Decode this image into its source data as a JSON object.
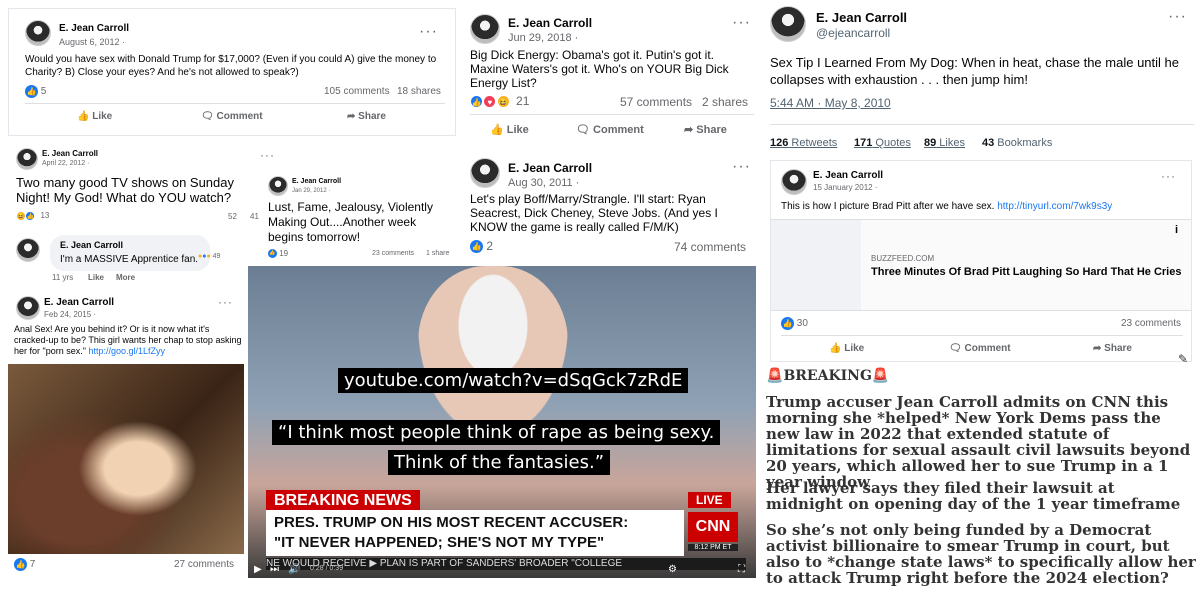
{
  "post1": {
    "name": "E. Jean Carroll",
    "date": "August 6, 2012 ·",
    "text": "Would you have sex with Donald Trump for $17,000?  (Even if you could A) give the money to Charity? B) Close your eyes?  And he's not allowed to speak?)",
    "reactions": "5",
    "comments": "105 comments",
    "shares": "18 shares",
    "like": "Like",
    "comment": "Comment",
    "share": "Share"
  },
  "post2": {
    "name": "E. Jean Carroll",
    "date": "Jun 29, 2018 ·",
    "text": "Big Dick Energy: Obama's got it. Putin's got it. Maxine Waters's got it. Who's on YOUR Big Dick Energy List?",
    "reactions": "21",
    "comments": "57 comments",
    "shares": "2 shares",
    "like": "Like",
    "comment": "Comment",
    "share": "Share"
  },
  "tweet": {
    "name": "E. Jean Carroll",
    "handle": "@ejeancarroll",
    "text": "Sex Tip I Learned From My Dog:  When in heat, chase the male until he collapses with exhaustion  . . . then jump him!",
    "timestamp": "5:44 AM · May 8, 2010",
    "retweets_num": "126",
    "retweets_label": " Retweets",
    "quotes_num": "171",
    "quotes_label": " Quotes",
    "likes_num": "89",
    "likes_label": " Likes",
    "bookmarks_num": "43",
    "bookmarks_label": " Bookmarks"
  },
  "post3": {
    "name": "E. Jean Carroll",
    "date": "April 22, 2012 ·",
    "text": "Two many good TV shows on Sunday Night! My God! What do YOU watch?",
    "reactions": "13",
    "comments": "52",
    "shares": "41",
    "reply_name": "E. Jean Carroll",
    "reply_text": "I'm a MASSIVE Apprentice fan.",
    "reply_reactions": "49",
    "reply_age": "11 yrs",
    "reply_like": "Like",
    "reply_more": "More"
  },
  "post4": {
    "name": "E. Jean Carroll",
    "date": "Jan 29, 2012 ·",
    "text": "Lust, Fame, Jealousy, Violently Making Out....Another week begins tomorrow!",
    "reactions": "19",
    "comments": "23 comments",
    "shares": "1 share"
  },
  "post5": {
    "name": "E. Jean Carroll",
    "date": "Aug 30, 2011 ·",
    "text": "Let's play Boff/Marry/Strangle.  I'll start: Ryan Seacrest, Dick Cheney, Steve Jobs.  (And yes I KNOW the game is really called F/M/K)",
    "reactions": "2",
    "comments": "74 comments"
  },
  "post6": {
    "name": "E. Jean Carroll",
    "date": "15 January 2012 ·",
    "text": "This is how I picture Brad Pitt after we have sex.",
    "link": "http://tinyurl.com/7wk9s3y",
    "source": "BUZZFEED.COM",
    "headline": "Three Minutes Of Brad Pitt Laughing So Hard That He Cries",
    "reactions": "30",
    "comments": "23 comments",
    "like": "Like",
    "comment": "Comment",
    "share": "Share"
  },
  "post7": {
    "name": "E. Jean Carroll",
    "date": "Feb 24, 2015 ·",
    "text": "Anal Sex!  Are you behind it? Or is it now what it's cracked-up to be? This girl wants her chap to stop asking her for \"porn sex.\"",
    "link": "http://goo.gl/1LfZyy",
    "reactions": "7",
    "comments": "27 comments"
  },
  "video": {
    "url": "youtube.com/watch?v=dSqGck7zRdE",
    "quote_line1": "“I think most people think of rape as being sexy.",
    "quote_line2": "Think of the fantasies.”",
    "banner_bg_text": "PLAN",
    "breaking": "BREAKING NEWS",
    "live": "LIVE",
    "headline_line1": "PRES. TRUMP ON HIS MOST RECENT ACCUSER:",
    "headline_line2": "\"IT NEVER HAPPENED; SHE'S NOT MY TYPE\"",
    "network": "CNN",
    "time": "8:12 PM ET",
    "ticker": "NE WOULD RECEIVE  ▶  PLAN IS PART OF SANDERS' BROADER \"COLLEGE",
    "timecode": "0:28 / 0:39"
  },
  "breaking": {
    "title": "BREAKING",
    "para1": "Trump accuser Jean Carroll admits on CNN this morning she *helped* New York Dems pass the new law in 2022 that extended statute of limitations for sexual assault civil lawsuits beyond 20 years, which allowed her to sue Trump in a 1 year window",
    "para2": "Her lawyer says they filed their lawsuit at midnight on opening day of the 1 year timeframe",
    "para3": "So she’s not only being funded by a Democrat activist billionaire to smear Trump in court, but also to *change state laws* to specifically allow her to attack Trump right before the 2024 election?"
  },
  "colors": {
    "fb_blue": "#1877f2",
    "muted": "#65676b",
    "cnn_red": "#cc0000",
    "tweet_link": "#536471"
  }
}
